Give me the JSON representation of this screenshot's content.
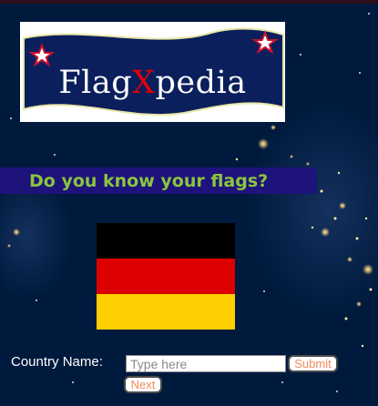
{
  "logo": {
    "text_before": "Flag",
    "text_x": "X",
    "text_after": "pedia",
    "colors": {
      "banner": "#0a1f5c",
      "x_letter": "#e0000b",
      "stars": "#ffffff",
      "star_outline": "#c8102e"
    }
  },
  "question": {
    "text": "Do you know your flags?",
    "color": "#8bc53f",
    "banner_color": "#1d137b"
  },
  "flag": {
    "stripes": [
      "#000000",
      "#dd0000",
      "#ffce00"
    ]
  },
  "form": {
    "country_label": "Country Name:",
    "input_value": "",
    "input_placeholder": "Type here",
    "submit_label": "Submit",
    "next_label": "Next",
    "button_text_color": "#f08a5a"
  },
  "theme": {
    "background": "#001a3d",
    "sparkle_color": "#ffd27a"
  }
}
